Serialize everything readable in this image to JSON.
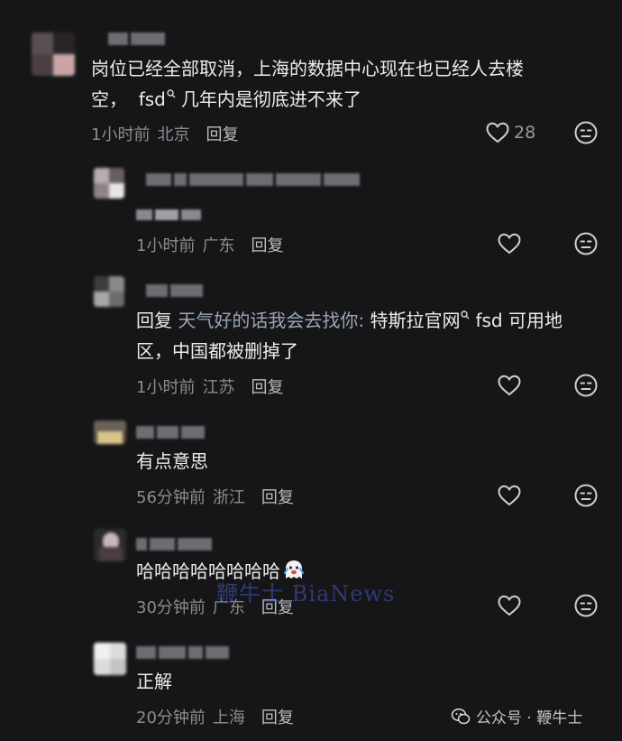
{
  "comments": [
    {
      "text_lines": [
        "岗位已经全部取消，上海的数据中心现在也已经人去楼",
        "空，",
        "几年内是彻底进不来了"
      ],
      "keyword": "fsd",
      "time": "1小时前",
      "location": "北京",
      "reply_label": "回复",
      "likes": "28"
    },
    {
      "text": "",
      "time": "1小时前",
      "location": "广东",
      "reply_label": "回复"
    },
    {
      "reply_prefix": "回复",
      "mention": "天气好的话我会去找你:",
      "text_part1": "特斯拉官网",
      "keyword": "fsd",
      "text_part2": "可用地",
      "text_line2": "区，中国都被删掉了",
      "time": "1小时前",
      "location": "江苏",
      "reply_label": "回复"
    },
    {
      "text": "有点意思",
      "time": "56分钟前",
      "location": "浙江",
      "reply_label": "回复"
    },
    {
      "text": "哈哈哈哈哈哈哈哈",
      "emoji_icon": "crying-laughing-ghost-emoji",
      "time": "30分钟前",
      "location": "广东",
      "reply_label": "回复"
    },
    {
      "text": "正解",
      "time": "20分钟前",
      "location": "上海",
      "reply_label": "回复"
    }
  ],
  "watermark": "鞭牛士 BiaNews",
  "footer": {
    "account": "公众号 · 鞭牛士",
    "icon": "wechat-icon"
  },
  "icons": {
    "like": "heart-outline-icon",
    "dislike": "meh-face-icon",
    "search_hint": "search-icon"
  },
  "colors": {
    "background": "#161618",
    "text": "#ececec",
    "meta": "#8c8c90",
    "mention": "#9aa6b8",
    "watermark": "#465ac8"
  }
}
